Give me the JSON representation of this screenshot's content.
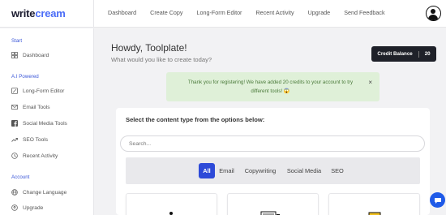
{
  "logo": {
    "part1": "write",
    "part2": "cream"
  },
  "nav": [
    "Dashboard",
    "Create Copy",
    "Long-Form Editor",
    "Recent Activity",
    "Upgrade",
    "Send Feedback"
  ],
  "sidebar": {
    "sections": [
      {
        "label": "Start"
      },
      {
        "label": "A.I Powered"
      },
      {
        "label": "Account"
      }
    ],
    "items": [
      {
        "label": "Dashboard",
        "icon": "dashboard-icon"
      },
      {
        "label": "Long-Form Editor",
        "icon": "edit-icon"
      },
      {
        "label": "Email Tools",
        "icon": "email-icon"
      },
      {
        "label": "Social Media Tools",
        "icon": "facebook-icon"
      },
      {
        "label": "SEO Tools",
        "icon": "trending-icon"
      },
      {
        "label": "Recent Activity",
        "icon": "clock-icon"
      },
      {
        "label": "Change Language",
        "icon": "globe-icon"
      },
      {
        "label": "Upgrade",
        "icon": "upgrade-icon"
      }
    ]
  },
  "main": {
    "greeting": "Howdy, Toolplate!",
    "subtitle": "What would you like to create today?",
    "credit": {
      "label": "Credit Balance",
      "value": "20"
    },
    "alert": {
      "text": "Thank you for registering! We have added 20 credits to your account to try different tools! 😱",
      "close": "×"
    },
    "content_title": "Select the content type from the options below:",
    "search_placeholder": "Search...",
    "tabs": [
      "All",
      "Email",
      "Copywriting",
      "Social Media",
      "SEO"
    ],
    "active_tab": "All"
  },
  "colors": {
    "brand": "#4a6cf7",
    "active_tab": "#2d4ad8",
    "alert_bg": "#dff0d8",
    "credit_bg": "#1f2129",
    "chat": "#1f5ae8"
  }
}
